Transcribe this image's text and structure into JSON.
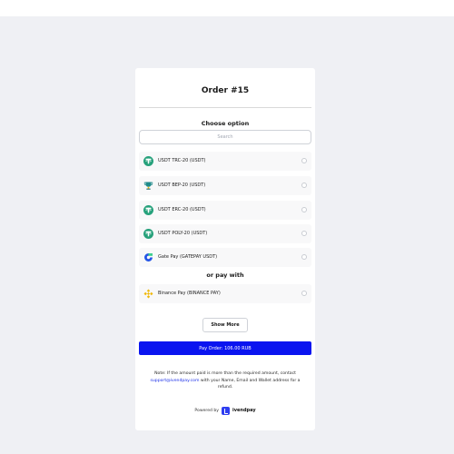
{
  "order": {
    "title": "Order #15"
  },
  "choose": {
    "title": "Choose option",
    "search_placeholder": "Search"
  },
  "options": [
    {
      "label": "USDT TRC-20 (USDT)",
      "icon": "tether-icon",
      "color": "#26a17b"
    },
    {
      "label": "USDT BEP-20 (USDT)",
      "icon": "trophy-icon",
      "color": "#1f8a8a"
    },
    {
      "label": "USDT ERC-20 (USDT)",
      "icon": "tether-icon",
      "color": "#26a17b"
    },
    {
      "label": "USDT POLY-20 (USDT)",
      "icon": "tether-icon",
      "color": "#26a17b"
    },
    {
      "label": "Gate Pay (GATEPAY USDT)",
      "icon": "gatepay-icon",
      "color": "#2354e6"
    }
  ],
  "or_pay": "or pay with",
  "other_options": [
    {
      "label": "Binance Pay (BINANCE PAY)",
      "icon": "binance-icon",
      "color": "#f0b90b"
    }
  ],
  "buttons": {
    "show_more": "Show More",
    "pay": "Pay Order: 106.00 RUB"
  },
  "note": {
    "before": "Note: If the amount paid is more than the required amount, contact",
    "email": "support@ivendpay.com",
    "after": "with your Name, Email and Wallet address for a refund."
  },
  "footer": {
    "powered_by": "Powered by",
    "brand": "ivendpay"
  },
  "colors": {
    "accent": "#0a14f0",
    "background": "#eff0f4",
    "card": "#ffffff"
  }
}
